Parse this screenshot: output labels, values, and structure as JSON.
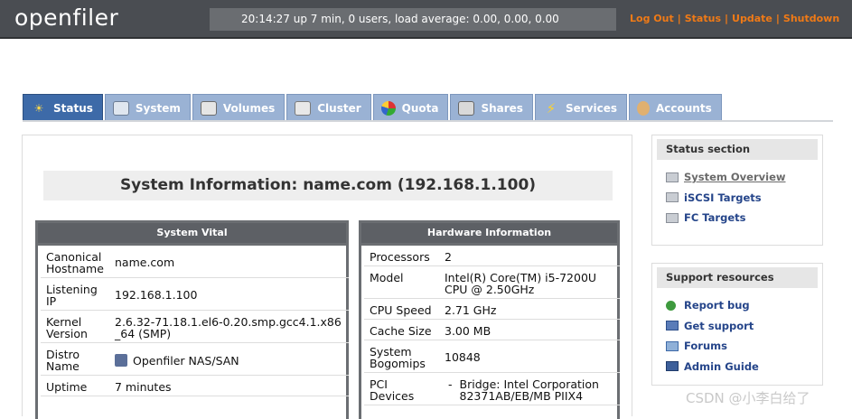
{
  "header": {
    "logo": "openfiler",
    "status_line": "20:14:27 up 7 min, 0 users, load average: 0.00, 0.00, 0.00",
    "links": [
      "Log Out",
      "Status",
      "Update",
      "Shutdown"
    ],
    "link_color": "#f07a16"
  },
  "tabs": [
    {
      "label": "Status",
      "icon": "sun-icon",
      "active": true
    },
    {
      "label": "System",
      "icon": "monitor-icon"
    },
    {
      "label": "Volumes",
      "icon": "drive-icon"
    },
    {
      "label": "Cluster",
      "icon": "cluster-icon"
    },
    {
      "label": "Quota",
      "icon": "pie-icon"
    },
    {
      "label": "Shares",
      "icon": "server-icon"
    },
    {
      "label": "Services",
      "icon": "lightning-icon"
    },
    {
      "label": "Accounts",
      "icon": "users-icon"
    }
  ],
  "main": {
    "title": "System Information: name.com (192.168.1.100)",
    "system_vital": {
      "heading": "System Vital",
      "rows": [
        {
          "key": "Canonical Hostname",
          "value": "name.com"
        },
        {
          "key": "Listening IP",
          "value": "192.168.1.100"
        },
        {
          "key": "Kernel Version",
          "value": "2.6.32-71.18.1.el6-0.20.smp.gcc4.1.x86_64 (SMP)"
        },
        {
          "key": "Distro Name",
          "value": "Openfiler NAS/SAN"
        },
        {
          "key": "Uptime",
          "value": "7 minutes"
        }
      ]
    },
    "hardware": {
      "heading": "Hardware Information",
      "rows": [
        {
          "key": "Processors",
          "value": "2"
        },
        {
          "key": "Model",
          "value": "Intel(R) Core(TM) i5-7200U CPU @ 2.50GHz"
        },
        {
          "key": "CPU Speed",
          "value": "2.71 GHz"
        },
        {
          "key": "Cache Size",
          "value": "3.00 MB"
        },
        {
          "key": "System Bogomips",
          "value": "10848"
        },
        {
          "key": "PCI Devices",
          "value": "Bridge: Intel Corporation 82371AB/EB/MB PIIX4"
        }
      ]
    }
  },
  "sidebar": {
    "status_section": {
      "heading": "Status section",
      "items": [
        "System Overview",
        "iSCSI Targets",
        "FC Targets"
      ]
    },
    "support": {
      "heading": "Support resources",
      "items": [
        "Report bug",
        "Get support",
        "Forums",
        "Admin Guide"
      ]
    }
  },
  "watermark": "CSDN @小李白给了"
}
